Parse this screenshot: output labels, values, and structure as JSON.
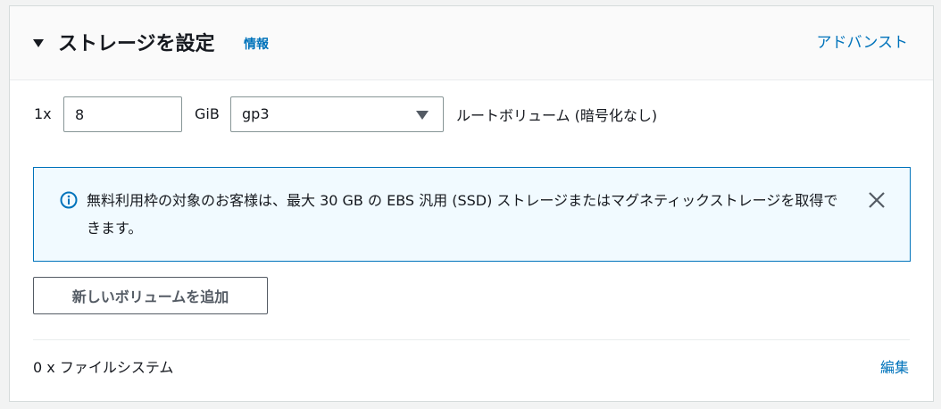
{
  "header": {
    "title": "ストレージを設定",
    "info_link": "情報",
    "advanced_link": "アドバンスト",
    "caret_icon": "caret-down-icon"
  },
  "volume": {
    "count_label": "1x",
    "size_value": "8",
    "size_unit": "GiB",
    "type_selected": "gp3",
    "description": "ルートボリューム  (暗号化なし)"
  },
  "alert": {
    "icon": "info-circle-icon",
    "text": "無料利用枠の対象のお客様は、最大 30 GB の EBS 汎用 (SSD) ストレージまたはマグネティックストレージを取得できます。",
    "close_icon": "close-icon"
  },
  "add_volume_button": "新しいボリュームを追加",
  "file_systems": {
    "label": "0 x ファイルシステム",
    "edit_link": "編集"
  },
  "colors": {
    "link": "#0073bb",
    "alert_bg": "#f1faff",
    "alert_border": "#0073bb",
    "text": "#16191f"
  }
}
